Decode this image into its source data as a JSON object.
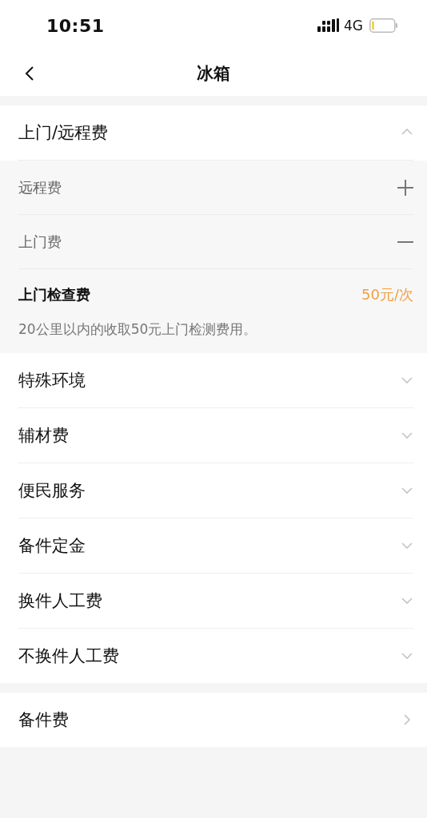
{
  "status_bar": {
    "time": "10:51",
    "network": "4G"
  },
  "nav": {
    "title": "冰箱"
  },
  "groups": [
    {
      "sections": [
        {
          "kind": "accordion",
          "title": "上门/远程费",
          "expanded": true,
          "children": [
            {
              "title": "远程费",
              "expanded": false
            },
            {
              "title": "上门费",
              "expanded": true,
              "items": [
                {
                  "name": "上门检查费",
                  "price": "50元/次",
                  "description": "20公里以内的收取50元上门检测费用。"
                }
              ]
            }
          ]
        },
        {
          "kind": "accordion",
          "title": "特殊环境",
          "expanded": false
        },
        {
          "kind": "accordion",
          "title": "辅材费",
          "expanded": false
        },
        {
          "kind": "accordion",
          "title": "便民服务",
          "expanded": false
        },
        {
          "kind": "accordion",
          "title": "备件定金",
          "expanded": false
        },
        {
          "kind": "accordion",
          "title": "换件人工费",
          "expanded": false
        },
        {
          "kind": "accordion",
          "title": "不换件人工费",
          "expanded": false
        }
      ]
    },
    {
      "sections": [
        {
          "kind": "link",
          "title": "备件费"
        }
      ]
    }
  ]
}
